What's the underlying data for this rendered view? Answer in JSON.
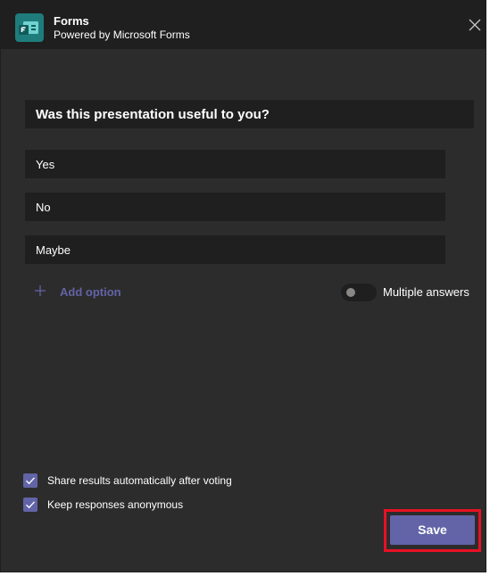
{
  "header": {
    "title": "Forms",
    "subtitle": "Powered by Microsoft Forms",
    "app_icon": "microsoft-forms-icon",
    "close_icon": "close-icon"
  },
  "question": {
    "text": "Was this presentation useful to you?"
  },
  "options": [
    {
      "label": "Yes"
    },
    {
      "label": "No"
    },
    {
      "label": "Maybe"
    }
  ],
  "add_option": {
    "label": "Add option",
    "icon": "plus-icon"
  },
  "multiple_answers": {
    "label": "Multiple answers",
    "enabled": false
  },
  "settings": [
    {
      "label": "Share results automatically after voting",
      "checked": true
    },
    {
      "label": "Keep responses anonymous",
      "checked": true
    }
  ],
  "actions": {
    "save_label": "Save"
  },
  "colors": {
    "accent": "#6264a7",
    "background": "#2d2c2c",
    "surface": "#1f1f1f",
    "app_icon": "#1f7c7c",
    "highlight": "#e81123"
  }
}
